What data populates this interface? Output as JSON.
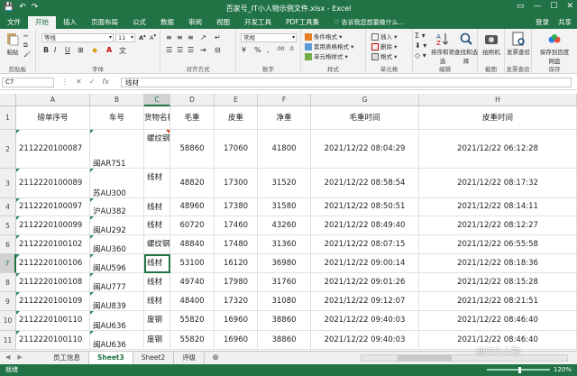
{
  "window": {
    "title": "百家号_IT小人物示例文件.xlsx - Excel",
    "login": "登录",
    "share": "共享"
  },
  "ribbon_tabs": [
    "文件",
    "开始",
    "插入",
    "页面布局",
    "公式",
    "数据",
    "审阅",
    "视图",
    "开发工具",
    "PDF工具集"
  ],
  "active_tab": "开始",
  "tell_me": "告诉我您想要做什么...",
  "ribbon": {
    "paste_label": "粘贴",
    "clipboard_label": "剪贴板",
    "font_name": "等线",
    "font_size": "11",
    "font_label": "字体",
    "align_label": "对齐方式",
    "number_format": "常规",
    "number_label": "数字",
    "cond_format": "条件格式",
    "table_format": "套用表格格式",
    "cell_style": "单元格样式",
    "styles_label": "样式",
    "insert_label": "插入",
    "delete_label": "删除",
    "format_label": "格式",
    "cells_label": "单元格",
    "sort_label": "排序和筛选",
    "find_label": "查找和选择",
    "edit_label": "编辑",
    "capture_label": "拍照机",
    "capture_group": "截图",
    "invoice_label": "发票查验",
    "invoice_group": "发票查验",
    "baidu_label": "保存到百度网盘",
    "baidu_group": "保存"
  },
  "formula_bar": {
    "name_box": "C7",
    "content": "线材"
  },
  "columns": [
    "A",
    "B",
    "C",
    "D",
    "E",
    "F",
    "G",
    "H"
  ],
  "selected_column": "C",
  "selected_row": "7",
  "headers": [
    "磅单序号",
    "车号",
    "货物名称",
    "毛重",
    "皮重",
    "净重",
    "毛重时间",
    "皮重时间"
  ],
  "rows": [
    {
      "num": "2",
      "a": "2112220100087",
      "b": "闽AR751",
      "c": "螺纹钢",
      "d": "58860",
      "e": "17060",
      "f": "41800",
      "g": "2021/12/22 08:04:29",
      "h": "2021/12/22 06:12:28"
    },
    {
      "num": "3",
      "a": "2112220100089",
      "b": "苏AU300",
      "c": "线材",
      "d": "48820",
      "e": "17300",
      "f": "31520",
      "g": "2021/12/22 08:58:54",
      "h": "2021/12/22 08:17:32"
    },
    {
      "num": "4",
      "a": "2112220100097",
      "b": "沪AU382",
      "c": "线材",
      "d": "48960",
      "e": "17380",
      "f": "31580",
      "g": "2021/12/22 08:50:51",
      "h": "2021/12/22 08:14:11"
    },
    {
      "num": "5",
      "a": "2112220100099",
      "b": "闽AU292",
      "c": "线材",
      "d": "60720",
      "e": "17460",
      "f": "43260",
      "g": "2021/12/22 08:49:40",
      "h": "2021/12/22 08:12:27"
    },
    {
      "num": "6",
      "a": "2112220100102",
      "b": "闽AU360",
      "c": "螺纹钢",
      "d": "48840",
      "e": "17480",
      "f": "31360",
      "g": "2021/12/22 08:07:15",
      "h": "2021/12/22 06:55:58"
    },
    {
      "num": "7",
      "a": "2112220100106",
      "b": "闽AU596",
      "c": "线材",
      "d": "53100",
      "e": "16120",
      "f": "36980",
      "g": "2021/12/22 09:00:14",
      "h": "2021/12/22 08:18:36"
    },
    {
      "num": "8",
      "a": "2112220100108",
      "b": "闽AU777",
      "c": "线材",
      "d": "49740",
      "e": "17980",
      "f": "31760",
      "g": "2021/12/22 09:01:26",
      "h": "2021/12/22 08:15:28"
    },
    {
      "num": "9",
      "a": "2112220100109",
      "b": "闽AU839",
      "c": "线材",
      "d": "48400",
      "e": "17320",
      "f": "31080",
      "g": "2021/12/22 09:12:07",
      "h": "2021/12/22 08:21:51"
    },
    {
      "num": "10",
      "a": "2112220100110",
      "b": "闽AU636",
      "c": "废钢",
      "d": "55820",
      "e": "16960",
      "f": "38860",
      "g": "2021/12/22 09:40:03",
      "h": "2021/12/22 08:46:40"
    },
    {
      "num": "11",
      "a": "2112220100110",
      "b": "闽AU636",
      "c": "废钢",
      "d": "55820",
      "e": "16960",
      "f": "38860",
      "g": "2021/12/22 09:40:03",
      "h": "2021/12/22 08:46:40"
    }
  ],
  "sheets": [
    "员工信息",
    "Sheet3",
    "Sheet2",
    "评级"
  ],
  "active_sheet": "Sheet3",
  "status": {
    "ready": "就绪",
    "zoom": "120%"
  },
  "watermark": "@IT小人物",
  "colors": {
    "excel_green": "#217346",
    "ribbon_bg": "#f3f3f3"
  }
}
